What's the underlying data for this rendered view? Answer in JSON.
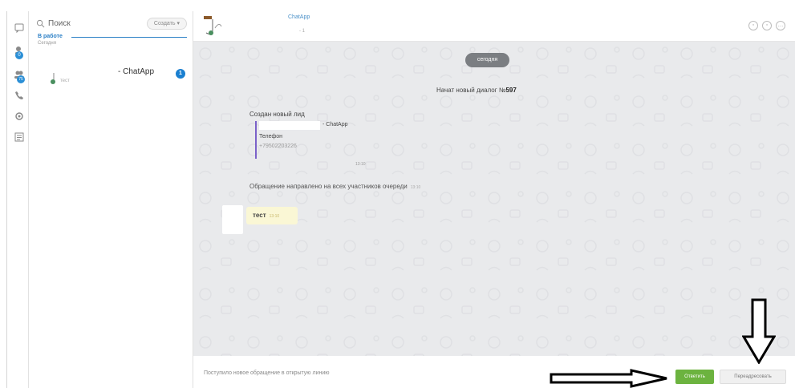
{
  "rail": {
    "icons": [
      "chat-icon",
      "user-badge-icon",
      "users-badge-icon",
      "phone-icon",
      "gear-icon",
      "list-icon"
    ],
    "badges": [
      "0",
      "75"
    ]
  },
  "chat_list": {
    "search_placeholder": "Поиск",
    "create_button": "Создать",
    "group_title": "В работе",
    "group_subtitle": "Сегодня",
    "items": [
      {
        "name": "- ChatApp",
        "preview": "тест",
        "unread": "1"
      }
    ]
  },
  "header": {
    "name": "ChatApp",
    "subtitle": "- 1"
  },
  "messages": {
    "date_label": "сегодня",
    "system_prefix": "Начат новый диалог №",
    "system_number": "597",
    "lead_title": "Создан новый лид",
    "lead_name": "- ChatApp",
    "lead_phone_label": "Телефон",
    "lead_phone": "+79502203226",
    "lead_time": "13:10",
    "route_text": "Обращение направлено на всех участников очереди",
    "route_time": "13:10",
    "incoming_text": "тест",
    "incoming_time": "13:10"
  },
  "footer": {
    "notice": "Поступило новое обращение в открытую линию",
    "reply_button": "Ответить",
    "forward_button": "Переадресовать"
  },
  "colors": {
    "accent_blue": "#2b7fc6",
    "reply_green": "#6cb33f",
    "lead_border": "#7b61c9",
    "feed_bg": "#e9eaec"
  }
}
